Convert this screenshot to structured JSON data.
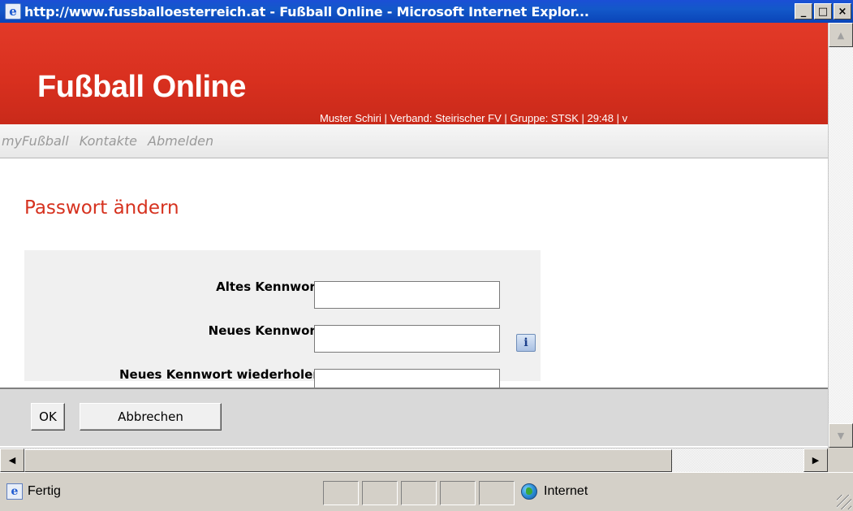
{
  "window": {
    "title": "http://www.fussballoesterreich.at - Fußball Online - Microsoft Internet Explor...",
    "buttons": {
      "minimize": "_",
      "maximize": "□",
      "close": "×"
    }
  },
  "header": {
    "logo": "Fußball Online",
    "userinfo": "Muster Schiri | Verband: Steirischer FV | Gruppe: STSK | 29:48 | v"
  },
  "nav": {
    "items": [
      {
        "label": "myFußball"
      },
      {
        "label": "Kontakte"
      },
      {
        "label": "Abmelden"
      }
    ]
  },
  "form": {
    "heading": "Passwort ändern",
    "fields": [
      {
        "label": "Altes Kennwort",
        "value": ""
      },
      {
        "label": "Neues Kennwort",
        "value": ""
      },
      {
        "label": "Neues Kennwort wiederholen",
        "value": ""
      }
    ],
    "info_icon": "i",
    "ok_label": "OK",
    "cancel_label": "Abbrechen"
  },
  "statusbar": {
    "status": "Fertig",
    "zone": "Internet"
  }
}
